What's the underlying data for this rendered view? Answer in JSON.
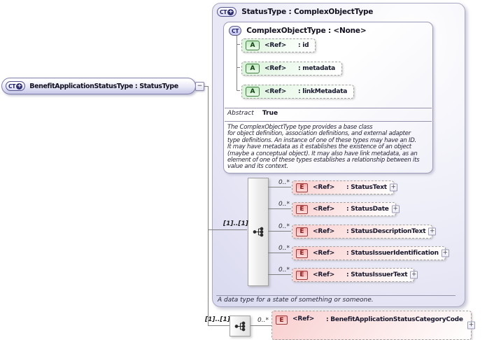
{
  "icons": {
    "ct": "CT",
    "attr": "A",
    "elem": "E",
    "expand": "+",
    "collapse": "−"
  },
  "colors": {
    "type_border": "#54548c",
    "attribute_green": "#3f7a3f",
    "element_red": "#9c3838",
    "box_lavender": "#d5d5ee"
  },
  "root": {
    "label": "BenefitApplicationStatusType : StatusType"
  },
  "status_type": {
    "title": "StatusType : ComplexObjectType",
    "base": {
      "title": "ComplexObjectType : <None>",
      "attributes": [
        {
          "ref": "<Ref>",
          "name": ": id"
        },
        {
          "ref": "<Ref>",
          "name": ": metadata"
        },
        {
          "ref": "<Ref>",
          "name": ": linkMetadata"
        }
      ],
      "facet_label": "Abstract",
      "facet_value": "True",
      "description": "The ComplexObjectType type provides a base class\nfor object definition, association definitions, and external adapter\ntype definitions. An instance of one of these types may have an ID.\nIt may have metadata as it establishes the existence of an object\n(maybe a conceptual object). It may also have link metadata, as an\nelement of one of these types establishes a relationship between its\nvalue and its context."
    },
    "sequence": {
      "cardinality": "[1]..[1]",
      "elements": [
        {
          "occurs": "0..*",
          "ref": "<Ref>",
          "name": ": StatusText"
        },
        {
          "occurs": "0..*",
          "ref": "<Ref>",
          "name": ": StatusDate"
        },
        {
          "occurs": "0..*",
          "ref": "<Ref>",
          "name": ": StatusDescriptionText"
        },
        {
          "occurs": "0..*",
          "ref": "<Ref>",
          "name": ": StatusIssuerIdentification"
        },
        {
          "occurs": "0..*",
          "ref": "<Ref>",
          "name": ": StatusIssuerText"
        }
      ]
    },
    "annotation": "A data type for a state of something or someone."
  },
  "extension": {
    "cardinality": "[1]..[1]",
    "elements": [
      {
        "occurs": "0..*",
        "ref": "<Ref>",
        "name": ": BenefitApplicationStatusCategoryCode"
      }
    ]
  }
}
